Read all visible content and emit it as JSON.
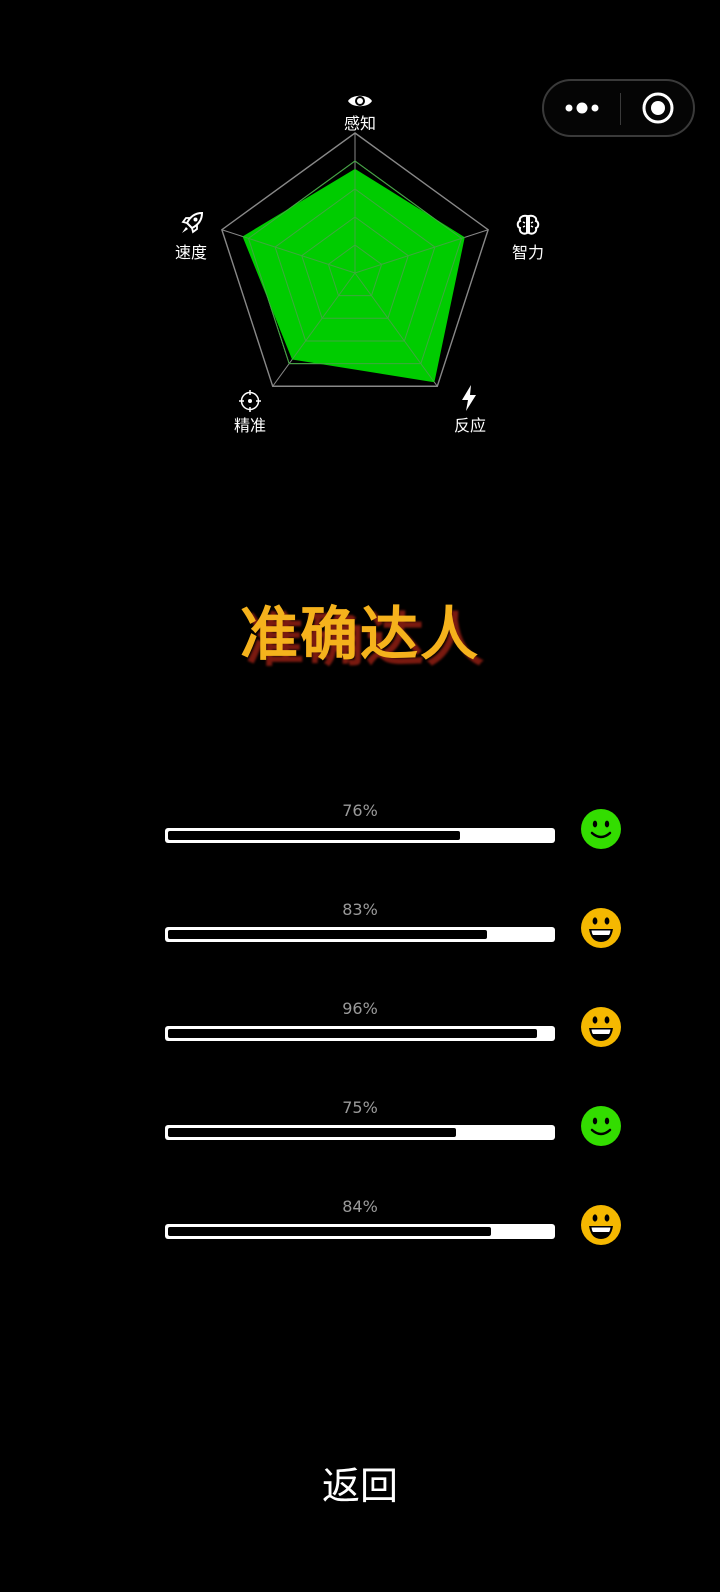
{
  "capsule": {
    "more_icon": "more-dots-icon",
    "close_icon": "target-circle-icon"
  },
  "radar": {
    "axes": [
      {
        "label": "感知",
        "icon": "eye-icon",
        "value": 0.74
      },
      {
        "label": "智力",
        "icon": "brain-icon",
        "value": 0.82
      },
      {
        "label": "反应",
        "icon": "lightning-icon",
        "value": 0.96
      },
      {
        "label": "精准",
        "icon": "crosshair-icon",
        "value": 0.76
      },
      {
        "label": "速度",
        "icon": "rocket-icon",
        "value": 0.84
      }
    ],
    "fill_color": "#00cc00",
    "grid_color": "#888888"
  },
  "title": "准确达人",
  "rows": [
    {
      "percent_label": "76%",
      "value": 0.76,
      "face": "smile-icon",
      "face_color": "#33dd00"
    },
    {
      "percent_label": "83%",
      "value": 0.83,
      "face": "grin-icon",
      "face_color": "#f5b800"
    },
    {
      "percent_label": "96%",
      "value": 0.96,
      "face": "grin-icon",
      "face_color": "#f5b800"
    },
    {
      "percent_label": "75%",
      "value": 0.75,
      "face": "smile-icon",
      "face_color": "#33dd00"
    },
    {
      "percent_label": "84%",
      "value": 0.84,
      "face": "grin-icon",
      "face_color": "#f5b800"
    }
  ],
  "back_label": "返回"
}
